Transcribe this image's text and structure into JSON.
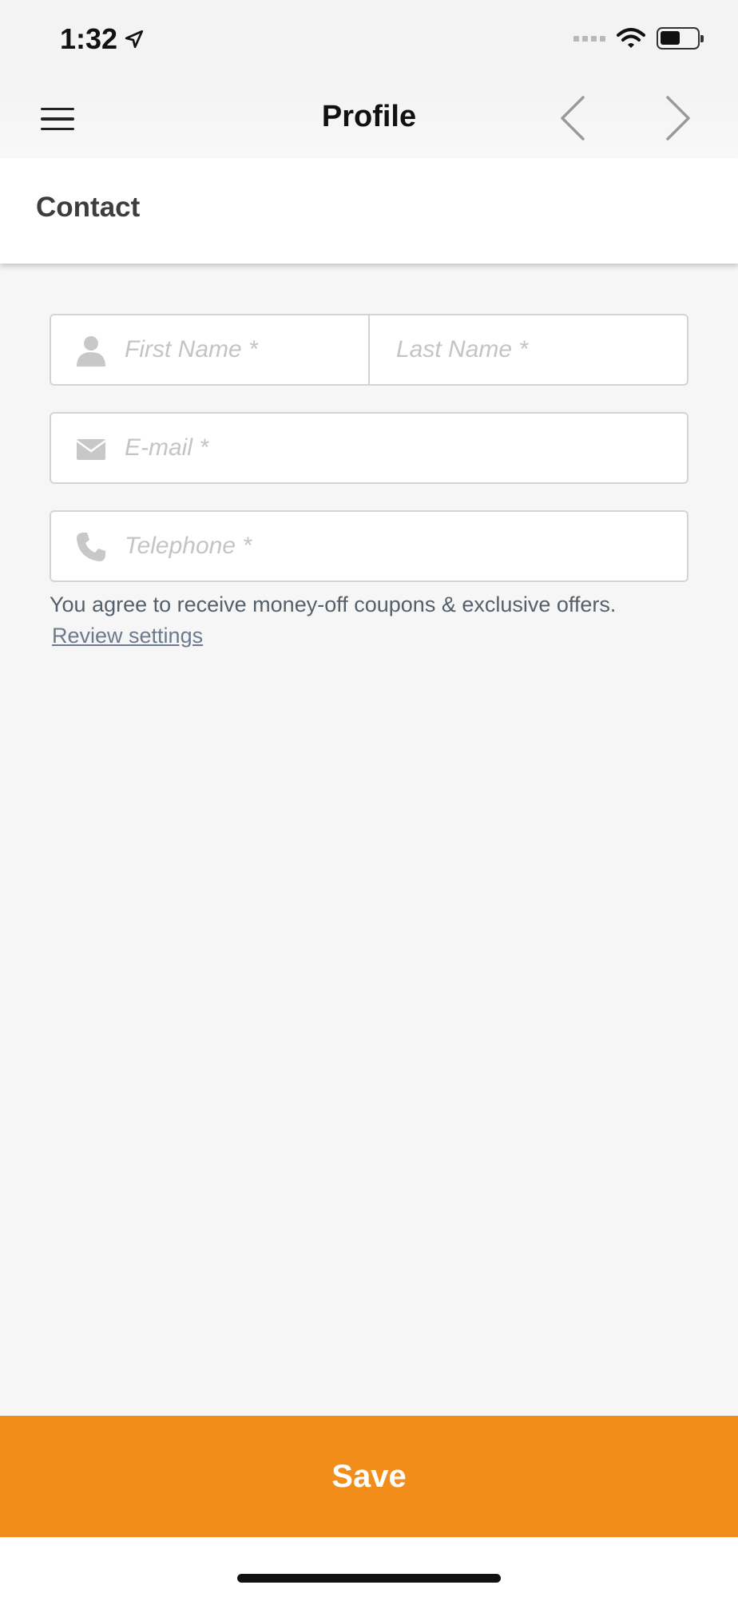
{
  "status_bar": {
    "time": "1:32",
    "icons": [
      "location-arrow-icon",
      "cellular-signal-icon",
      "wifi-icon",
      "battery-icon"
    ]
  },
  "nav": {
    "title": "Profile",
    "icons": [
      "hamburger-menu-icon",
      "chevron-left-icon",
      "chevron-right-icon"
    ]
  },
  "section": {
    "title": "Contact"
  },
  "form": {
    "first_name_placeholder": "First Name *",
    "last_name_placeholder": "Last Name *",
    "email_placeholder": "E-mail *",
    "telephone_placeholder": "Telephone *",
    "icons": [
      "person-icon",
      "envelope-icon",
      "phone-icon"
    ]
  },
  "consent": {
    "text": "You agree to receive money-off coupons & exclusive offers.",
    "link_label": "Review settings"
  },
  "footer": {
    "save_label": "Save"
  },
  "colors": {
    "accent": "#f28d1a",
    "background": "#f6f6f6",
    "placeholder": "#c4c4c4",
    "link": "#6b7a8d"
  }
}
